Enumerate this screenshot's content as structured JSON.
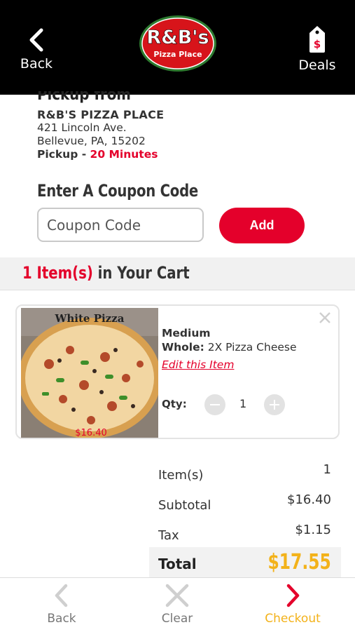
{
  "header": {
    "back_label": "Back",
    "deals_label": "Deals",
    "logo_text_main": "R&B's",
    "logo_text_sub": "Pizza Place"
  },
  "pickup": {
    "heading": "Pickup from",
    "store_name": "R&B'S PIZZA PLACE",
    "address_line1": "421 Lincoln Ave.",
    "address_line2": "Bellevue, PA, 15202",
    "time_prefix": "Pickup - ",
    "time_value": "20 Minutes"
  },
  "coupon": {
    "title": "Enter A Coupon Code",
    "placeholder": "Coupon Code",
    "add_label": "Add"
  },
  "cart": {
    "count": "1 Item(s)",
    "title_suffix": " in Your Cart",
    "item": {
      "image_caption": "White Pizza",
      "image_price": "$16.40",
      "size": "Medium",
      "whole_label": "Whole:",
      "whole_value": "2X Pizza Cheese",
      "edit_label": "Edit this Item",
      "qty_label": "Qty:",
      "qty_value": "1"
    }
  },
  "summary": {
    "items_label": "Item(s)",
    "items_value": "1",
    "subtotal_label": "Subtotal",
    "subtotal_value": "$16.40",
    "tax_label": "Tax",
    "tax_value": "$1.15",
    "total_label": "Total",
    "total_value": "$17.55"
  },
  "bottom_bar": {
    "back_label": "Back",
    "clear_label": "Clear",
    "checkout_label": "Checkout"
  },
  "colors": {
    "accent_red": "#e4002b",
    "accent_gold": "#f3b21a",
    "header_bg": "#000000"
  }
}
